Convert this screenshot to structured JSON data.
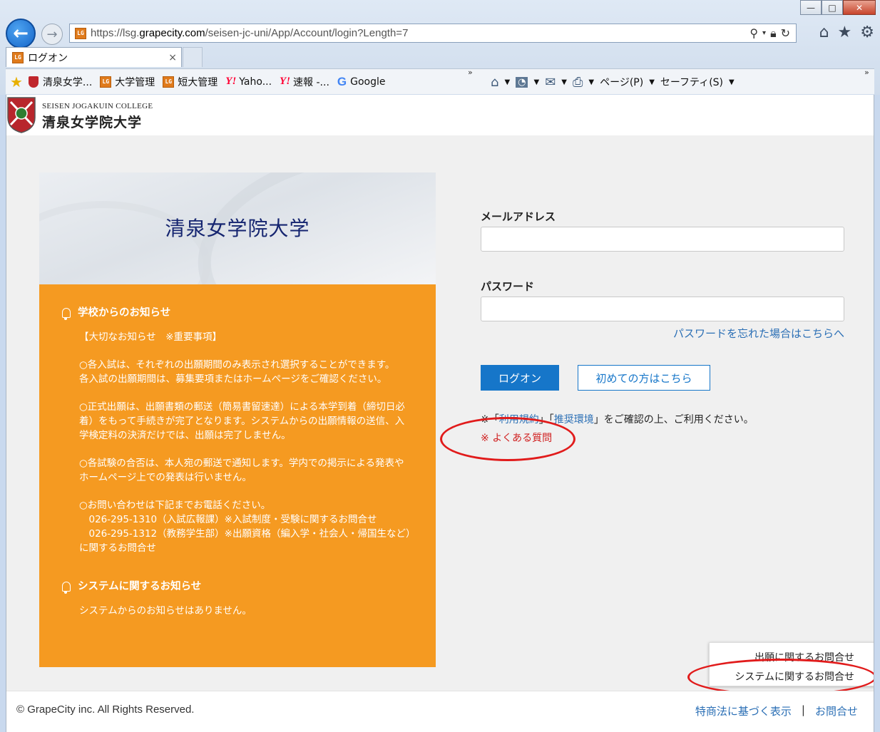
{
  "window": {
    "minimize": "—",
    "maximize": "□",
    "close": "✕"
  },
  "nav": {
    "back_glyph": "←",
    "forward_glyph": "→"
  },
  "address_bar": {
    "url_prefix": "https://lsg.",
    "url_domain": "grapecity.com",
    "url_path": "/seisen-jc-uni/App/Account/login?Length=7",
    "favicon_text": "LG"
  },
  "tab": {
    "title": "ログオン",
    "close": "×"
  },
  "favorites": {
    "items": [
      {
        "label": "清泉女学...",
        "icon": "crest-icon"
      },
      {
        "label": "大学管理",
        "icon": "lg-icon"
      },
      {
        "label": "短大管理",
        "icon": "lg-icon"
      },
      {
        "label": "Yaho...",
        "icon": "yahoo-icon"
      },
      {
        "label": "速報 -...",
        "icon": "yahoo-icon"
      },
      {
        "label": "Google",
        "icon": "google-icon"
      }
    ],
    "chevron": "»"
  },
  "command_bar": {
    "page": "ページ(P)",
    "safety": "セーフティ(S)"
  },
  "site": {
    "logo_en": "SEISEN JOGAKUIN COLLEGE",
    "logo_ja": "清泉女学院大学",
    "hero_title": "清泉女学院大学"
  },
  "notices": {
    "school_heading": "学校からのお知らせ",
    "school_paragraphs": [
      "【大切なお知らせ　※重要事項】",
      "○各入試は、それぞれの出願期間のみ表示され選択することができます。\n各入試の出願期間は、募集要項またはホームページをご確認ください。",
      "○正式出願は、出願書類の郵送（簡易書留速達）による本学到着（締切日必着）をもって手続きが完了となります。システムからの出願情報の送信、入学検定料の決済だけでは、出願は完了しません。",
      "○各試験の合否は、本人宛の郵送で通知します。学内での掲示による発表やホームページ上での発表は行いません。",
      "○お問い合わせは下記までお電話ください。\n　026-295-1310（入試広報課）※入試制度・受験に関するお問合せ\n　026-295-1312（教務学生部）※出願資格（編入学・社会人・帰国生など）に関するお問合せ"
    ],
    "system_heading": "システムに関するお知らせ",
    "system_text": "システムからのお知らせはありません。"
  },
  "form": {
    "email_label": "メールアドレス",
    "email_value": "",
    "password_label": "パスワード",
    "password_value": "",
    "forgot_link": "パスワードを忘れた場合はこちらへ",
    "login_button": "ログオン",
    "first_time_button": "初めての方はこちら",
    "terms_prefix": "※「",
    "terms_link": "利用規約",
    "terms_mid": "」「",
    "env_link": "推奨環境",
    "terms_suffix": "」をご確認の上、ご利用ください。",
    "faq_mark": "※",
    "faq_link": "よくある質問"
  },
  "contact_panel": {
    "application_inquiry": "出願に関するお問合せ",
    "system_inquiry": "システムに関するお問合せ"
  },
  "footer": {
    "copyright": "© GrapeCity inc. All Rights Reserved.",
    "legal_link": "特商法に基づく表示",
    "separator": "|",
    "contact_link": "お問合せ"
  },
  "colors": {
    "notice_bg": "#f59a21",
    "primary_blue": "#1676c9",
    "annotation_red": "#e11b1b",
    "hero_title": "#152570"
  }
}
